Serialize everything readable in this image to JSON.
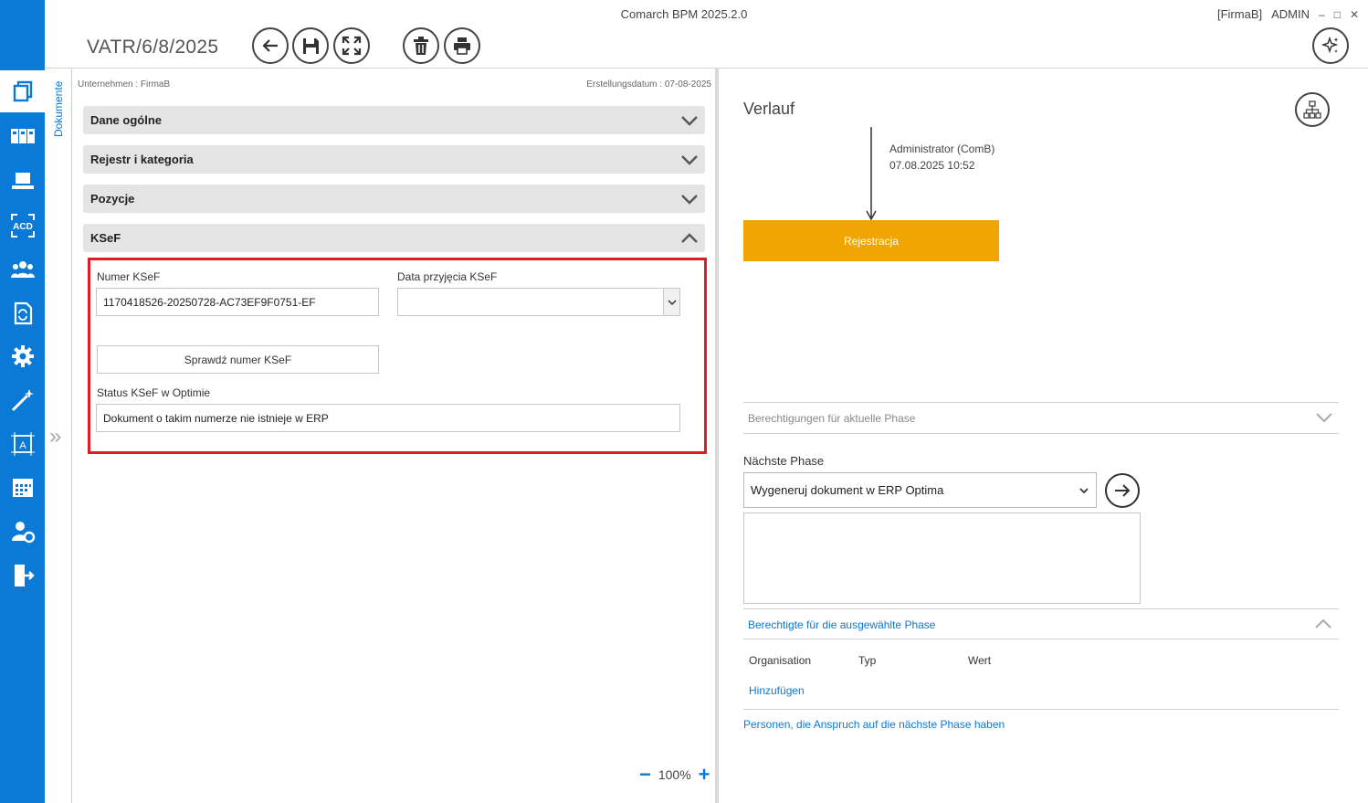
{
  "app": {
    "window_title": "Comarch BPM 2025.2.0",
    "company_tag": "[FirmaB]",
    "user": "ADMIN",
    "minimize": "–",
    "maximize": "□",
    "close": "✕"
  },
  "rail": {
    "items": [
      {
        "icon": "documents-icon"
      },
      {
        "icon": "binders-icon"
      },
      {
        "icon": "laptop-icon"
      },
      {
        "icon": "acd-scan-icon"
      },
      {
        "icon": "users-icon"
      },
      {
        "icon": "document-sync-icon"
      },
      {
        "icon": "gear-icon"
      },
      {
        "icon": "magic-wand-icon"
      },
      {
        "icon": "designer-icon"
      },
      {
        "icon": "calendar-icon"
      },
      {
        "icon": "user-settings-icon"
      },
      {
        "icon": "exit-icon"
      }
    ]
  },
  "toolbar": {
    "document_number": "VATR/6/8/2025",
    "buttons": [
      "back-icon",
      "save-icon",
      "fullscreen-icon",
      "delete-icon",
      "print-icon",
      "ai-sparkle-icon"
    ]
  },
  "side_tab": {
    "label": "Dokumente",
    "expand": "»"
  },
  "form": {
    "company_meta": "Unternehmen : FirmaB",
    "created_meta": "Erstellungsdatum : 07-08-2025",
    "sections": [
      {
        "title": "Dane ogólne",
        "expanded": false
      },
      {
        "title": "Rejestr i kategoria",
        "expanded": false
      },
      {
        "title": "Pozycje",
        "expanded": false
      },
      {
        "title": "KSeF",
        "expanded": true
      }
    ],
    "ksef": {
      "number_label": "Numer KSeF",
      "number_value": "1170418526-20250728-AC73EF9F0751-EF",
      "date_label": "Data przyjęcia KSeF",
      "date_value": "",
      "check_button": "Sprawdź numer KSeF",
      "status_label": "Status KSeF w Optimie",
      "status_value": "Dokument o takim numerze nie istnieje w ERP"
    },
    "zoom": {
      "minus": "−",
      "value": "100%",
      "plus": "+"
    }
  },
  "history": {
    "title": "Verlauf",
    "user": "Administrator (ComB)",
    "date": "07.08.2025 10:52",
    "phase": "Rejestracja",
    "phase_color": "#f0a500"
  },
  "permissions": {
    "current_phase": "Berechtigungen für aktuelle Phase",
    "next_phase_label": "Nächste Phase",
    "next_phase_value": "Wygeneruj dokument w ERP Optima",
    "selected_phase": "Berechtigte für die ausgewählte Phase",
    "columns": [
      "Organisation",
      "Typ",
      "Wert"
    ],
    "add_link": "Hinzufügen",
    "persons_link": "Personen, die Anspruch auf die nächste Phase haben"
  }
}
